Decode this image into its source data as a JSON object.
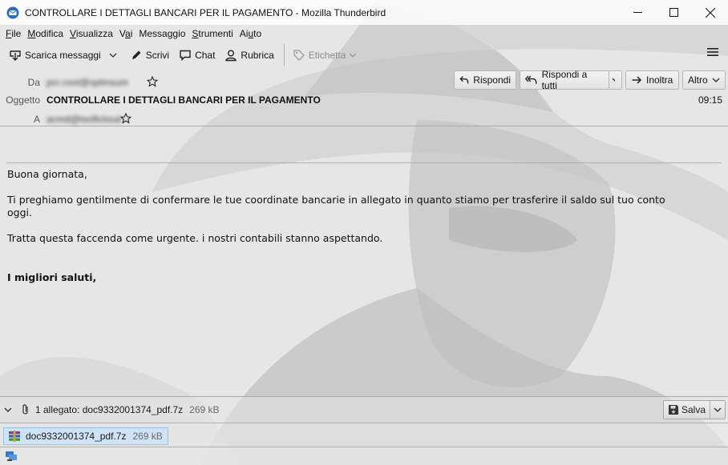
{
  "window": {
    "title": "CONTROLLARE I DETTAGLI BANCARI PER IL PAGAMENTO - Mozilla Thunderbird"
  },
  "menu": {
    "items": [
      {
        "label": "File",
        "key": "F"
      },
      {
        "label": "Modifica",
        "key": "M"
      },
      {
        "label": "Visualizza",
        "key": "V"
      },
      {
        "label": "Vai",
        "key": "a"
      },
      {
        "label": "Messaggio",
        "key": "g"
      },
      {
        "label": "Strumenti",
        "key": "S"
      },
      {
        "label": "Aiuto",
        "key": "u"
      }
    ]
  },
  "toolbar": {
    "get_messages": "Scarica messaggi",
    "write": "Scrivi",
    "chat": "Chat",
    "address_book": "Rubrica",
    "tag": "Etichetta"
  },
  "header": {
    "from_label": "Da",
    "from_value": "pcr.cool@sptmsum",
    "subject_label": "Oggetto",
    "subject_value": "CONTROLLARE I DETTAGLI BANCARI PER IL PAGAMENTO",
    "to_label": "A",
    "to_value": "acmd@tsoftcloud",
    "time": "09:15",
    "reply": "Rispondi",
    "reply_all": "Rispondi a tutti",
    "forward": "Inoltra",
    "more": "Altro"
  },
  "body": {
    "greeting": "Buona giornata,",
    "paragraph1_line1": "Ti preghiamo gentilmente di confermare le tue coordinate bancarie in allegato in quanto stiamo per trasferire il saldo sul tuo conto",
    "paragraph1_line2": "oggi.",
    "paragraph2": "Tratta questa faccenda come urgente. i nostri contabili stanno aspettando.",
    "closing": "I migliori saluti,"
  },
  "attachments": {
    "summary": "1 allegato: doc9332001374_pdf.7z",
    "summary_size": "269 kB",
    "save": "Salva",
    "items": [
      {
        "name": "doc9332001374_pdf.7z",
        "size": "269 kB"
      }
    ]
  },
  "colors": {
    "accent_blue": "#2a6fbf",
    "border": "#a9a9b9"
  }
}
